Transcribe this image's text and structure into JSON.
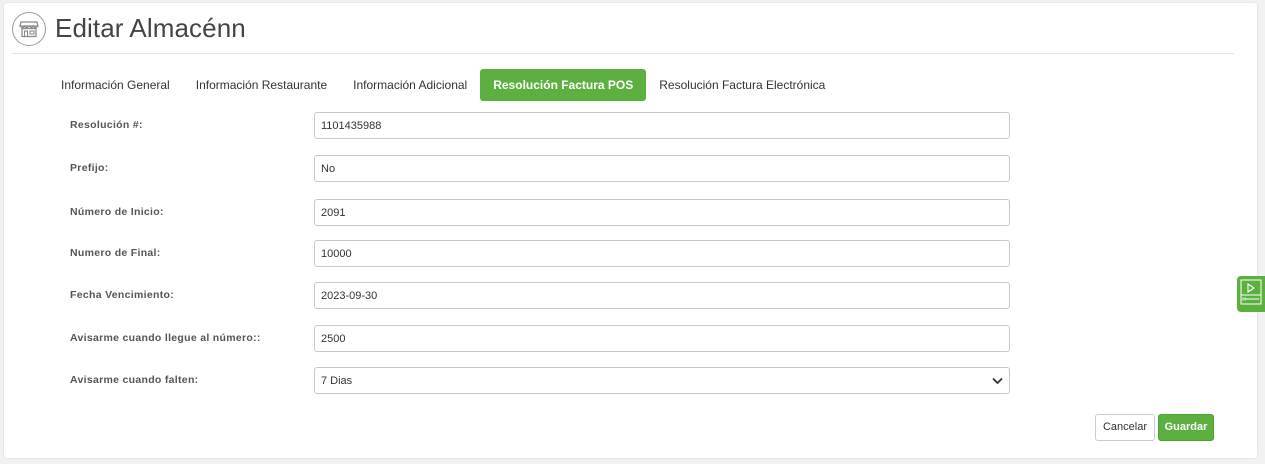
{
  "header": {
    "title": "Editar Almacénn",
    "icon": "store-icon"
  },
  "tabs": [
    {
      "label": "Información General",
      "active": false
    },
    {
      "label": "Información Restaurante",
      "active": false
    },
    {
      "label": "Información Adicional",
      "active": false
    },
    {
      "label": "Resolución Factura POS",
      "active": true
    },
    {
      "label": "Resolución Factura Electrónica",
      "active": false
    }
  ],
  "form": {
    "resolucion": {
      "label": "Resolución #:",
      "value": "1101435988"
    },
    "prefijo": {
      "label": "Prefijo:",
      "value": "No"
    },
    "numero_inicio": {
      "label": "Número de Inicio:",
      "value": "2091"
    },
    "numero_final": {
      "label": "Numero de Final:",
      "value": "10000"
    },
    "fecha_vencimiento": {
      "label": "Fecha Vencimiento:",
      "value": "2023-09-30"
    },
    "avisar_numero": {
      "label": "Avisarme cuando llegue al número::",
      "value": "2500"
    },
    "avisar_faltan": {
      "label": "Avisarme cuando falten:",
      "value": "7 Dias"
    }
  },
  "actions": {
    "cancel_label": "Cancelar",
    "save_label": "Guardar"
  },
  "colors": {
    "accent": "#5cb040"
  },
  "side_widget": {
    "icon": "play-panel-icon"
  }
}
